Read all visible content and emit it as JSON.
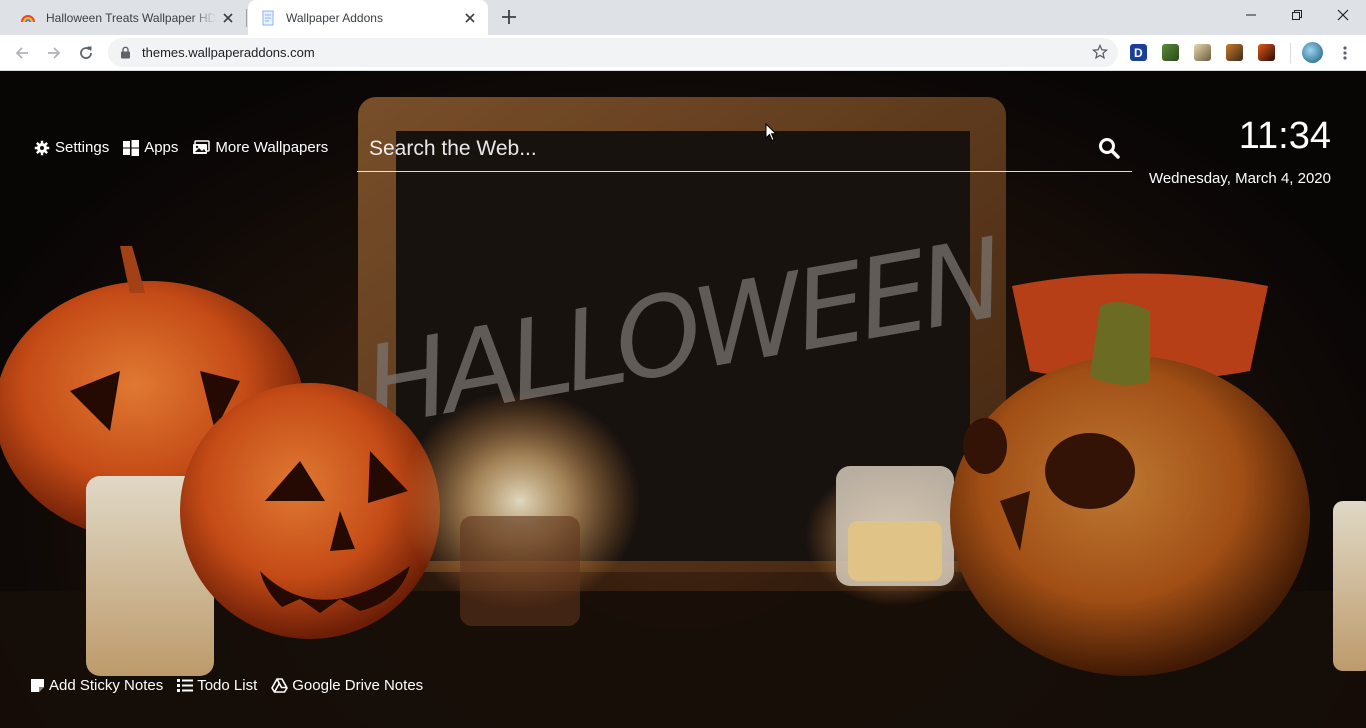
{
  "browser": {
    "tabs": [
      {
        "title": "Halloween Treats Wallpaper HD New Tab Theme",
        "active": false
      },
      {
        "title": "Wallpaper Addons",
        "active": true
      }
    ],
    "url": "themes.wallpaperaddons.com"
  },
  "page": {
    "nav": {
      "settings": "Settings",
      "apps": "Apps",
      "more_wallpapers": "More Wallpapers"
    },
    "search": {
      "placeholder": "Search the Web..."
    },
    "clock": {
      "time": "11:34",
      "date": "Wednesday, March 4, 2020"
    },
    "tools": {
      "sticky_notes": "Add Sticky Notes",
      "todo": "Todo List",
      "drive_notes": "Google Drive Notes"
    },
    "wallpaper_text": "HALLOWEEN"
  },
  "colors": {
    "chrome_tabstrip": "#dee1e6",
    "omnibox": "#f1f3f4",
    "pumpkin": "#e0561a",
    "text": "#ffffff"
  }
}
